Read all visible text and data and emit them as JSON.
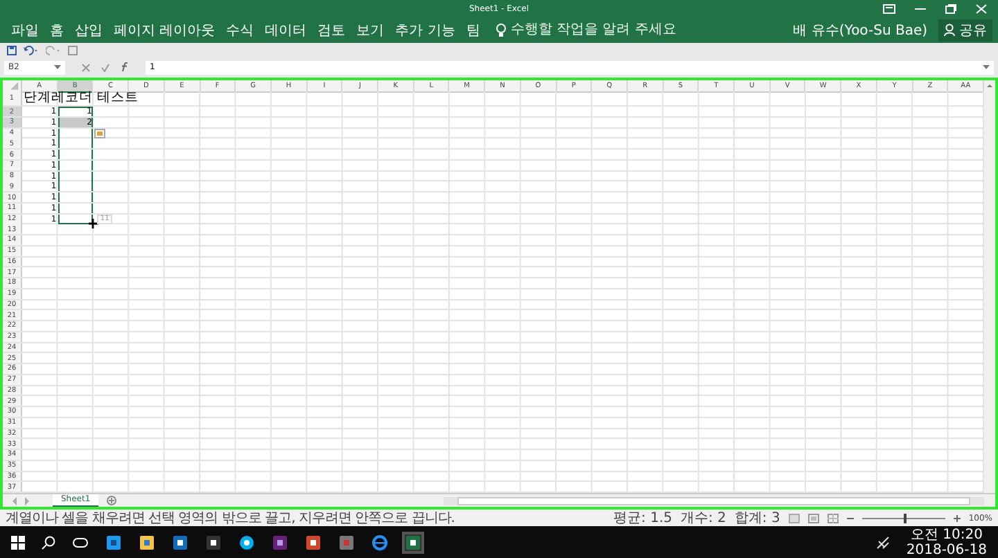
{
  "window": {
    "title": "Sheet1 - Excel"
  },
  "ribbon_tabs": [
    {
      "label": "파일"
    },
    {
      "label": "홈"
    },
    {
      "label": "삽입"
    },
    {
      "label": "페이지 레이아웃"
    },
    {
      "label": "수식"
    },
    {
      "label": "데이터"
    },
    {
      "label": "검토"
    },
    {
      "label": "보기"
    },
    {
      "label": "추가 기능"
    },
    {
      "label": "팀"
    }
  ],
  "tell_me": {
    "placeholder": "수행할 작업을 알려 주세요"
  },
  "user": {
    "name": "배 유수(Yoo-Su Bae)"
  },
  "share_button": {
    "label": "공유"
  },
  "formula_bar": {
    "name_box": "B2",
    "value": "1"
  },
  "columns": [
    {
      "label": "A",
      "selected": false
    },
    {
      "label": "B",
      "selected": true
    },
    {
      "label": "C",
      "selected": false
    },
    {
      "label": "D",
      "selected": false
    },
    {
      "label": "E",
      "selected": false
    },
    {
      "label": "F",
      "selected": false
    },
    {
      "label": "G",
      "selected": false
    },
    {
      "label": "H",
      "selected": false
    },
    {
      "label": "I",
      "selected": false
    },
    {
      "label": "J",
      "selected": false
    },
    {
      "label": "K",
      "selected": false
    },
    {
      "label": "L",
      "selected": false
    },
    {
      "label": "M",
      "selected": false
    },
    {
      "label": "N",
      "selected": false
    },
    {
      "label": "O",
      "selected": false
    },
    {
      "label": "P",
      "selected": false
    },
    {
      "label": "Q",
      "selected": false
    },
    {
      "label": "R",
      "selected": false
    },
    {
      "label": "S",
      "selected": false
    },
    {
      "label": "T",
      "selected": false
    },
    {
      "label": "U",
      "selected": false
    },
    {
      "label": "V",
      "selected": false
    },
    {
      "label": "W",
      "selected": false
    },
    {
      "label": "X",
      "selected": false
    },
    {
      "label": "Y",
      "selected": false
    },
    {
      "label": "Z",
      "selected": false
    },
    {
      "label": "AA",
      "selected": false
    }
  ],
  "rows": [
    {
      "label": "1",
      "selected": false,
      "cells": [
        {
          "kind": "text",
          "text": "단계레코더 테스트",
          "selected": false,
          "shaded": false
        }
      ]
    },
    {
      "label": "2",
      "selected": true,
      "cells": [
        {
          "kind": "number",
          "text": "1",
          "selected": false,
          "shaded": false
        },
        {
          "kind": "number",
          "text": "1",
          "selected": true,
          "shaded": false
        }
      ]
    },
    {
      "label": "3",
      "selected": true,
      "cells": [
        {
          "kind": "number",
          "text": "1",
          "selected": false,
          "shaded": false
        },
        {
          "kind": "number",
          "text": "2",
          "selected": true,
          "shaded": true
        }
      ]
    },
    {
      "label": "4",
      "selected": false,
      "cells": [
        {
          "kind": "number",
          "text": "1",
          "selected": false,
          "shaded": false
        },
        {
          "kind": "number",
          "selected": true,
          "shaded": false
        }
      ]
    },
    {
      "label": "5",
      "selected": false,
      "cells": [
        {
          "kind": "number",
          "text": "1",
          "selected": false,
          "shaded": false
        },
        {
          "kind": "number",
          "selected": true,
          "shaded": false
        }
      ]
    },
    {
      "label": "6",
      "selected": false,
      "cells": [
        {
          "kind": "number",
          "text": "1",
          "selected": false,
          "shaded": false
        },
        {
          "kind": "number",
          "selected": true,
          "shaded": false
        }
      ]
    },
    {
      "label": "7",
      "selected": false,
      "cells": [
        {
          "kind": "number",
          "text": "1",
          "selected": false,
          "shaded": false
        },
        {
          "kind": "number",
          "selected": true,
          "shaded": false
        }
      ]
    },
    {
      "label": "8",
      "selected": false,
      "cells": [
        {
          "kind": "number",
          "text": "1",
          "selected": false,
          "shaded": false
        },
        {
          "kind": "number",
          "selected": true,
          "shaded": false
        }
      ]
    },
    {
      "label": "9",
      "selected": false,
      "cells": [
        {
          "kind": "number",
          "text": "1",
          "selected": false,
          "shaded": false
        },
        {
          "kind": "number",
          "selected": true,
          "shaded": false
        }
      ]
    },
    {
      "label": "10",
      "selected": false,
      "cells": [
        {
          "kind": "number",
          "text": "1",
          "selected": false,
          "shaded": false
        },
        {
          "kind": "number",
          "selected": true,
          "shaded": false
        }
      ]
    },
    {
      "label": "11",
      "selected": false,
      "cells": [
        {
          "kind": "number",
          "text": "1",
          "selected": false,
          "shaded": false
        },
        {
          "kind": "number",
          "selected": true,
          "shaded": false
        }
      ]
    },
    {
      "label": "12",
      "selected": false,
      "cells": [
        {
          "kind": "number",
          "text": "1",
          "selected": false,
          "shaded": false
        },
        {
          "kind": "number",
          "selected": true,
          "shaded": false
        }
      ]
    },
    {
      "label": "13"
    },
    {
      "label": "14"
    },
    {
      "label": "15"
    },
    {
      "label": "16"
    },
    {
      "label": "17"
    },
    {
      "label": "18"
    },
    {
      "label": "19"
    },
    {
      "label": "20"
    },
    {
      "label": "21"
    },
    {
      "label": "22"
    },
    {
      "label": "23"
    },
    {
      "label": "24"
    },
    {
      "label": "25"
    },
    {
      "label": "26"
    },
    {
      "label": "27"
    },
    {
      "label": "28"
    },
    {
      "label": "29"
    },
    {
      "label": "30"
    },
    {
      "label": "31"
    },
    {
      "label": "32"
    },
    {
      "label": "33"
    },
    {
      "label": "34"
    },
    {
      "label": "35"
    },
    {
      "label": "36"
    },
    {
      "label": "37"
    }
  ],
  "fill_tooltip": "11",
  "sheet_tabs": [
    {
      "label": "Sheet1",
      "selected": true
    }
  ],
  "status_bar": {
    "message": "계열이나 셀을 채우려면 선택 영역의 밖으로 끌고, 지우려면 안쪽으로 끕니다.",
    "stats": [
      "평균: 1.5",
      "개수: 2",
      "합계: 3"
    ],
    "zoom_slider": {
      "level": 0.5
    },
    "zoom": "100%"
  },
  "taskbar": {
    "time": "오전 10:20",
    "date": "2018-06-18"
  }
}
